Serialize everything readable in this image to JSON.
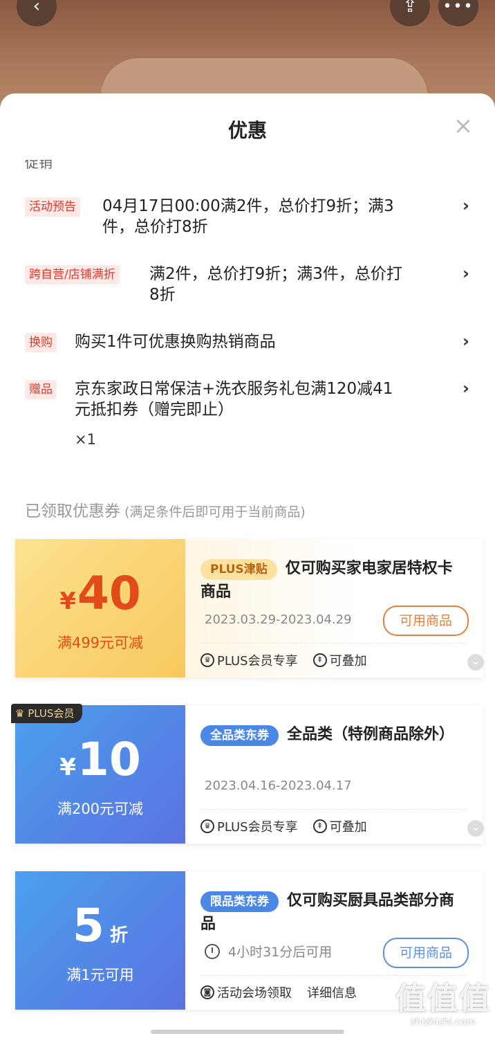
{
  "sheet": {
    "title": "优惠",
    "close": "×",
    "cut_heading": "促销"
  },
  "promotions": [
    {
      "tag": "活动预告",
      "line1": "04月17日00:00满2件，总价打9折；满3",
      "line2": "件，总价打8折"
    },
    {
      "tag": "跨自营/店铺满折",
      "line1": "满2件，总价打9折；满3件，总价打",
      "line2": "8折"
    },
    {
      "tag": "换购",
      "line1": "购买1件可优惠换购热销商品"
    },
    {
      "tag": "赠品",
      "line1": "京东家政日常保洁+洗衣服务礼包满120减41",
      "line2": "元抵扣券（赠完即止）",
      "qty": "×1"
    }
  ],
  "chevron": "›",
  "coupons_section": {
    "title": "已领取优惠券",
    "subtitle": "(满足条件后即可用于当前商品)"
  },
  "coupons": [
    {
      "currency": "¥",
      "amount": "40",
      "condition": "满499元可减",
      "tag": "PLUS津贴",
      "title": "仅可购买家电家居特权卡商品",
      "date": "2023.03.29-2023.04.29",
      "button": "可用商品",
      "foot1": "PLUS会员专享",
      "foot2": "可叠加"
    },
    {
      "badge": "PLUS会员",
      "currency": "¥",
      "amount": "10",
      "condition": "满200元可减",
      "tag": "全品类东券",
      "title": "全品类（特例商品除外）",
      "date": "2023.04.16-2023.04.17",
      "foot1": "PLUS会员专享",
      "foot2": "可叠加"
    },
    {
      "amount": "5",
      "unit": "折",
      "condition": "满1元可用",
      "tag": "限品类东券",
      "title": "仅可购买厨具品类部分商品",
      "countdown": "4小时31分后可用",
      "button": "可用商品",
      "foot1": "活动会场领取",
      "foot2": "详细信息"
    }
  ],
  "watermark": {
    "logo": "值值值",
    "site": "zhizhizhi.com"
  },
  "colors": {
    "accent_red": "#e3382c",
    "gold": "#f8c85d",
    "blue": "#5b72e0"
  }
}
